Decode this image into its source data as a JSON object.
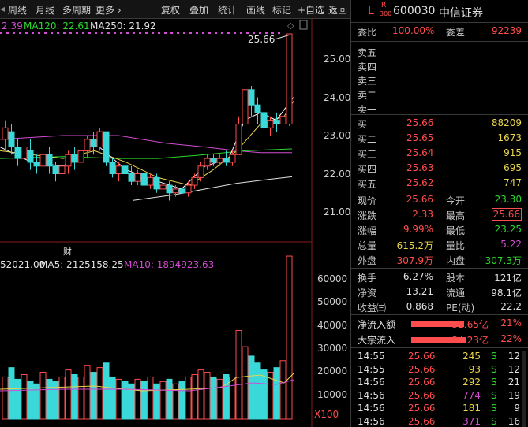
{
  "toolbar": {
    "items": [
      "周线",
      "月线",
      "多周期",
      "更多 ›",
      "复权",
      "叠加",
      "统计",
      "画线",
      "标记",
      "+自选",
      "返回"
    ]
  },
  "ma_legend": {
    "ma60": "2.39",
    "ma120": "MA120: 22.61",
    "ma250": "MA250: 21.92"
  },
  "price_axis": [
    "25.00",
    "24.00",
    "23.00",
    "22.00",
    "21.00"
  ],
  "high_label": "25.66",
  "marker_cai": "财",
  "vol_legend": {
    "vol": "52021.00",
    "ma5": "MA5: 2125158.25",
    "ma10": "MA10: 1894923.63"
  },
  "vol_axis": [
    "60000",
    "50000",
    "40000",
    "30000",
    "20000",
    "10000"
  ],
  "vol_unit": "X100",
  "colors": {
    "up": "#ff4d4d",
    "down": "#3ad8d8",
    "ma5": "#ffffff",
    "ma10": "#e8d44d",
    "ma20": "#d24dd2",
    "ma60": "#2ad82a"
  },
  "panel": {
    "symbol_letter": "L",
    "badge_r": "R",
    "badge_300": "300",
    "code": "600030",
    "name": "中信证券",
    "weibi_label": "委比",
    "weibi": "100.00%",
    "weicha_label": "委差",
    "weicha": "92239",
    "asks": [
      {
        "label": "卖五",
        "price": "",
        "vol": ""
      },
      {
        "label": "卖四",
        "price": "",
        "vol": ""
      },
      {
        "label": "卖三",
        "price": "",
        "vol": ""
      },
      {
        "label": "卖二",
        "price": "",
        "vol": ""
      },
      {
        "label": "卖一",
        "price": "",
        "vol": ""
      }
    ],
    "bids": [
      {
        "label": "买一",
        "price": "25.66",
        "vol": "88209"
      },
      {
        "label": "买二",
        "price": "25.65",
        "vol": "1673"
      },
      {
        "label": "买三",
        "price": "25.64",
        "vol": "915"
      },
      {
        "label": "买四",
        "price": "25.63",
        "vol": "695"
      },
      {
        "label": "买五",
        "price": "25.62",
        "vol": "747"
      }
    ],
    "stats": [
      {
        "l1": "现价",
        "v1": "25.66",
        "c1": "red",
        "l2": "今开",
        "v2": "23.30",
        "c2": "green"
      },
      {
        "l1": "涨跌",
        "v1": "2.33",
        "c1": "red",
        "l2": "最高",
        "v2": "25.66",
        "c2": "red"
      },
      {
        "l1": "涨幅",
        "v1": "9.99%",
        "c1": "red",
        "l2": "最低",
        "v2": "23.25",
        "c2": "green"
      },
      {
        "l1": "总量",
        "v1": "615.2万",
        "c1": "yellow",
        "l2": "量比",
        "v2": "5.22",
        "c2": "magenta"
      },
      {
        "l1": "外盘",
        "v1": "307.9万",
        "c1": "red",
        "l2": "内盘",
        "v2": "307.3万",
        "c2": "green"
      }
    ],
    "stats2": [
      {
        "l1": "换手",
        "v1": "6.27%",
        "l2": "股本",
        "v2": "121亿"
      },
      {
        "l1": "净资",
        "v1": "13.21",
        "l2": "流通",
        "v2": "98.1亿"
      },
      {
        "l1": "收益㈢",
        "v1": "0.868",
        "l2": "PE(动)",
        "v2": "22.2"
      }
    ],
    "flows": [
      {
        "label": "净流入额",
        "value": "32.65亿",
        "pct": "21%",
        "bar_fraction": 0.21
      },
      {
        "label": "大宗流入",
        "value": "34.23亿",
        "pct": "22%",
        "bar_fraction": 0.22
      }
    ],
    "ticks": [
      {
        "time": "14:55",
        "price": "25.66",
        "vol": "245",
        "side": "S",
        "n": "12"
      },
      {
        "time": "14:55",
        "price": "25.66",
        "vol": "93",
        "side": "S",
        "n": "12"
      },
      {
        "time": "14:56",
        "price": "25.66",
        "vol": "292",
        "side": "S",
        "n": "21"
      },
      {
        "time": "14:56",
        "price": "25.66",
        "vol": "774",
        "side": "S",
        "n": "19"
      },
      {
        "time": "14:56",
        "price": "25.66",
        "vol": "181",
        "side": "S",
        "n": "9"
      },
      {
        "time": "14:56",
        "price": "25.66",
        "vol": "371",
        "side": "S",
        "n": "16"
      }
    ]
  }
}
